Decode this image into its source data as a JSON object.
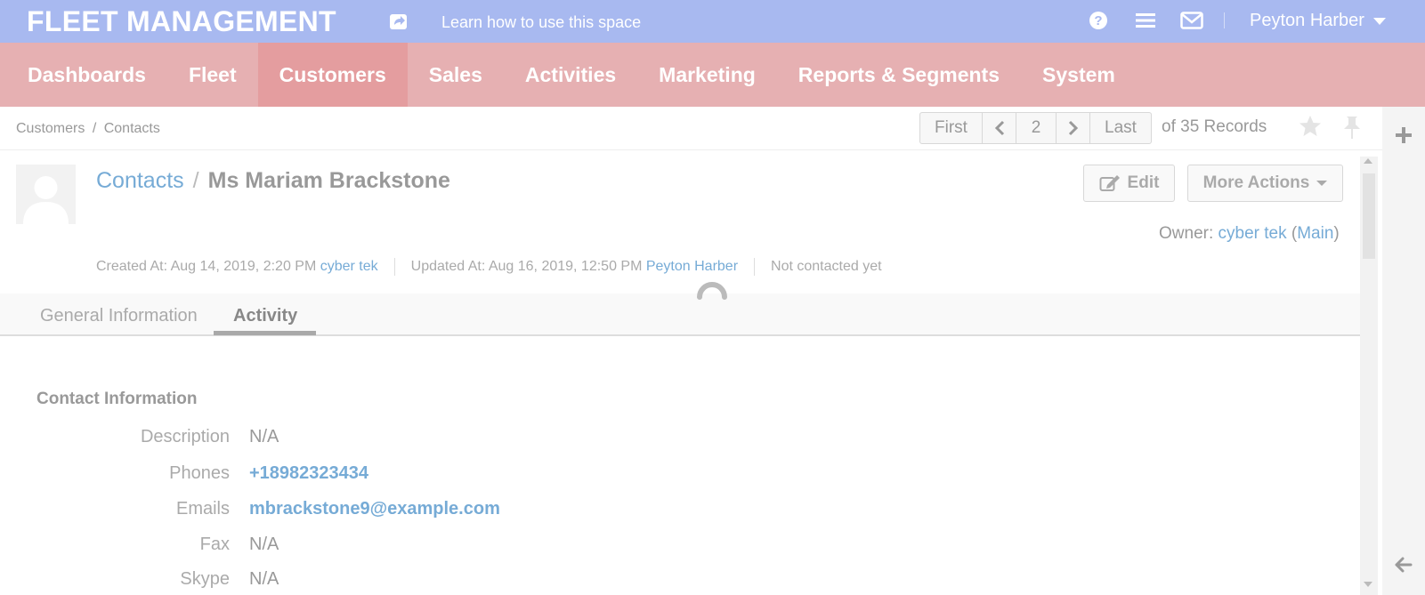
{
  "topbar": {
    "brand": "FLEET MANAGEMENT",
    "learn_link": "Learn how to use this space",
    "user_name": "Peyton Harber",
    "icons": [
      "share-icon",
      "help-icon",
      "menu-icon",
      "mail-icon",
      "chevron-down-icon"
    ]
  },
  "nav": {
    "items": [
      {
        "label": "Dashboards"
      },
      {
        "label": "Fleet"
      },
      {
        "label": "Customers",
        "active": true
      },
      {
        "label": "Sales"
      },
      {
        "label": "Activities"
      },
      {
        "label": "Marketing"
      },
      {
        "label": "Reports & Segments"
      },
      {
        "label": "System"
      }
    ]
  },
  "breadcrumb": {
    "items": [
      "Customers",
      "Contacts"
    ],
    "separator": "/"
  },
  "pager": {
    "first": "First",
    "current": "2",
    "last": "Last",
    "records": "of 35 Records"
  },
  "record": {
    "crumb": "Contacts",
    "slash": "/",
    "name": "Ms Mariam Brackstone",
    "edit_label": "Edit",
    "more_actions_label": "More Actions",
    "owner_label": "Owner:",
    "owner_name": "cyber tek",
    "owner_unit": "Main",
    "created_label": "Created At: Aug 14, 2019, 2:20 PM",
    "created_by": "cyber tek",
    "updated_label": "Updated At: Aug 16, 2019, 12:50 PM",
    "updated_by": "Peyton Harber",
    "contact_status": "Not contacted yet"
  },
  "tabs": [
    {
      "label": "General Information"
    },
    {
      "label": "Activity",
      "active": true
    }
  ],
  "contact_info": {
    "title": "Contact Information",
    "fields": [
      {
        "label": "Description",
        "value": "N/A"
      },
      {
        "label": "Phones",
        "value": "+18982323434"
      },
      {
        "label": "Emails",
        "value": "mbrackstone9@example.com"
      },
      {
        "label": "Fax",
        "value": "N/A"
      },
      {
        "label": "Skype",
        "value": "N/A"
      }
    ]
  },
  "colors": {
    "topbar": "#a8b9f0",
    "nav": "#e6b0b2",
    "nav_active": "#e49d9f",
    "link": "#76abd6"
  }
}
